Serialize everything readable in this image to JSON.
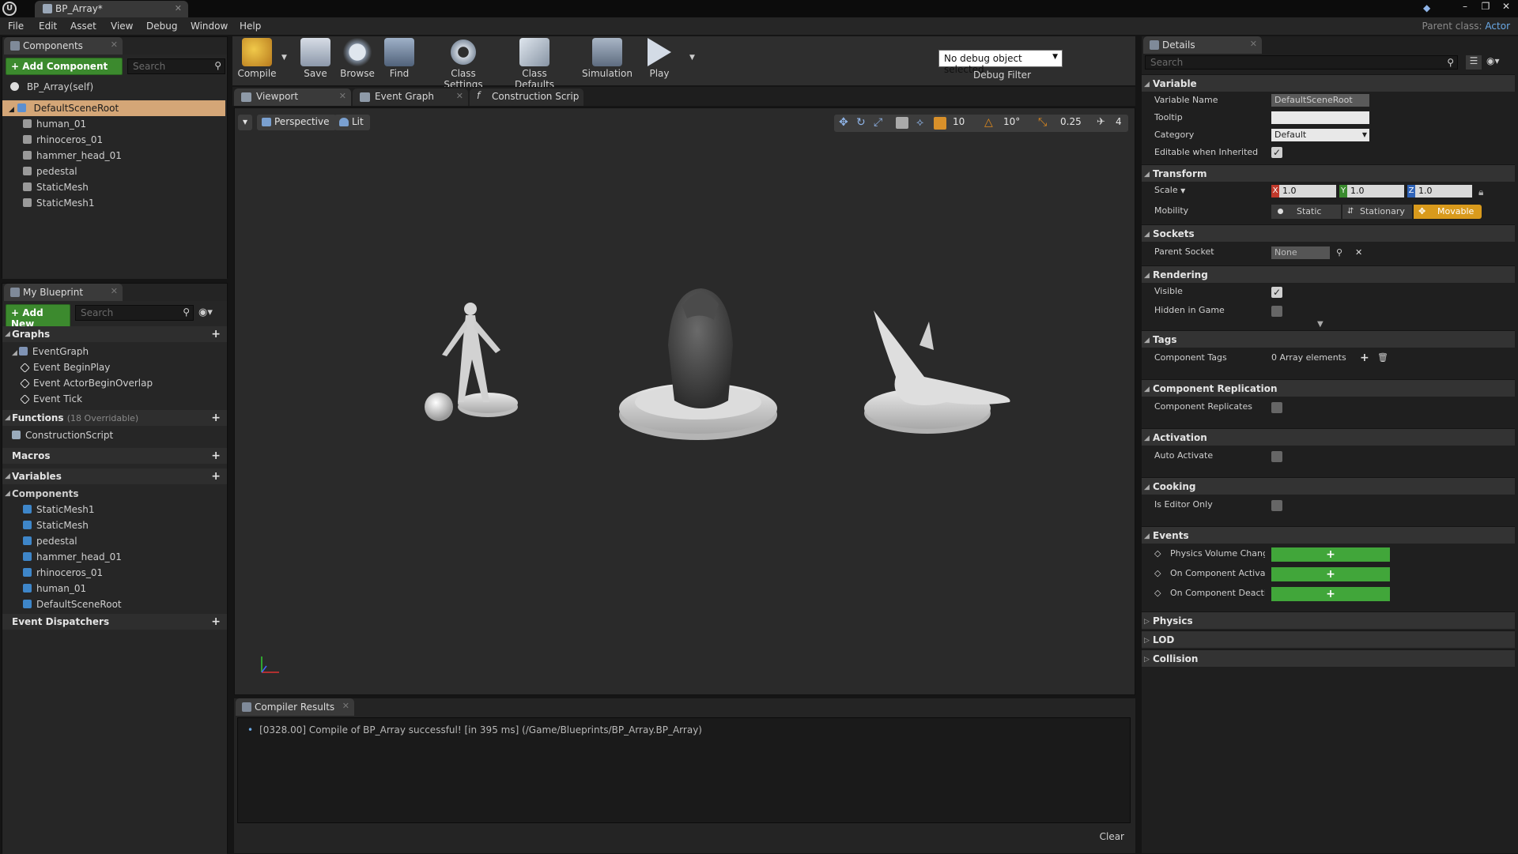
{
  "window": {
    "tab_title": "BP_Array*",
    "parent_class_label": "Parent class:",
    "parent_class_value": "Actor"
  },
  "menu": [
    "File",
    "Edit",
    "Asset",
    "View",
    "Debug",
    "Window",
    "Help"
  ],
  "components_panel": {
    "tab": "Components",
    "add_button": "+ Add Component",
    "search_placeholder": "Search",
    "self_label": "BP_Array(self)",
    "tree": [
      "DefaultSceneRoot",
      "human_01",
      "rhinoceros_01",
      "hammer_head_01",
      "pedestal",
      "StaticMesh",
      "StaticMesh1"
    ]
  },
  "my_blueprint": {
    "tab": "My Blueprint",
    "add_button": "+ Add New",
    "search_placeholder": "Search",
    "graphs_label": "Graphs",
    "graph_items": [
      "EventGraph",
      "Event BeginPlay",
      "Event ActorBeginOverlap",
      "Event Tick"
    ],
    "functions_label": "Functions",
    "functions_sub": "(18 Overridable)",
    "function_items": [
      "ConstructionScript"
    ],
    "macros_label": "Macros",
    "variables_label": "Variables",
    "components_label": "Components",
    "component_vars": [
      "StaticMesh1",
      "StaticMesh",
      "pedestal",
      "hammer_head_01",
      "rhinoceros_01",
      "human_01",
      "DefaultSceneRoot"
    ],
    "dispatchers_label": "Event Dispatchers"
  },
  "toolbar": {
    "compile": "Compile",
    "save": "Save",
    "browse": "Browse",
    "find": "Find",
    "class_settings": "Class Settings",
    "class_defaults": "Class Defaults",
    "simulation": "Simulation",
    "play": "Play",
    "debug_select": "No debug object selected",
    "debug_filter": "Debug Filter"
  },
  "editor_tabs": [
    "Viewport",
    "Event Graph",
    "Construction Scrip"
  ],
  "viewport": {
    "perspective": "Perspective",
    "lit": "Lit",
    "grid": "10",
    "rot": "10°",
    "scale": "0.25",
    "cam": "4"
  },
  "compiler": {
    "tab": "Compiler Results",
    "message": "[0328.00] Compile of BP_Array successful! [in 395 ms] (/Game/Blueprints/BP_Array.BP_Array)",
    "clear": "Clear"
  },
  "details": {
    "tab": "Details",
    "search_placeholder": "Search",
    "variable": {
      "header": "Variable",
      "name_label": "Variable Name",
      "name_value": "DefaultSceneRoot",
      "tooltip_label": "Tooltip",
      "category_label": "Category",
      "category_value": "Default",
      "editable_label": "Editable when Inherited"
    },
    "transform": {
      "header": "Transform",
      "scale_label": "Scale",
      "x": "1.0",
      "y": "1.0",
      "z": "1.0",
      "mobility_label": "Mobility",
      "static": "Static",
      "stationary": "Stationary",
      "movable": "Movable"
    },
    "sockets": {
      "header": "Sockets",
      "parent_label": "Parent Socket",
      "parent_value": "None"
    },
    "rendering": {
      "header": "Rendering",
      "visible": "Visible",
      "hidden": "Hidden in Game"
    },
    "tags": {
      "header": "Tags",
      "label": "Component Tags",
      "value": "0 Array elements"
    },
    "replication": {
      "header": "Component Replication",
      "label": "Component Replicates"
    },
    "activation": {
      "header": "Activation",
      "label": "Auto Activate"
    },
    "cooking": {
      "header": "Cooking",
      "label": "Is Editor Only"
    },
    "events": {
      "header": "Events",
      "items": [
        "Physics Volume Change",
        "On Component Activated",
        "On Component Deactiva"
      ]
    },
    "collapsed": [
      "Physics",
      "LOD",
      "Collision"
    ]
  }
}
